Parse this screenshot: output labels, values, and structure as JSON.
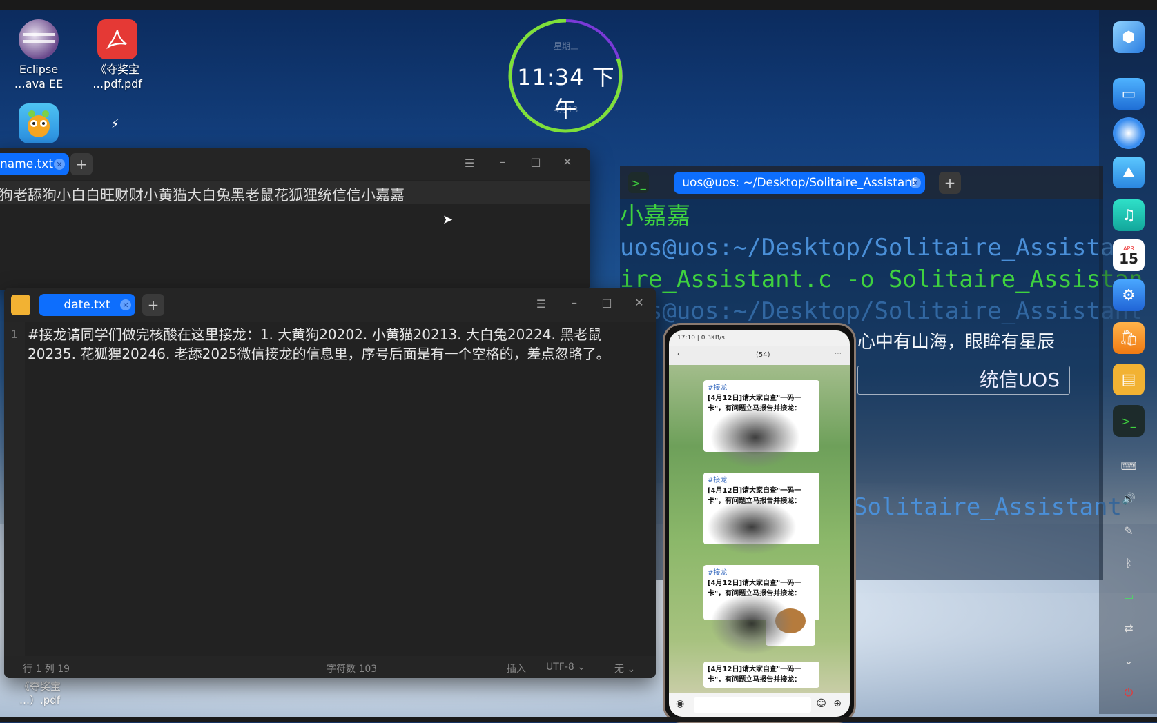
{
  "desktop": {
    "icons": [
      {
        "label_line1": "Eclipse",
        "label_line2": "…ava EE",
        "icon": "eclipse-icon"
      },
      {
        "label_line1": "《夺奖宝",
        "label_line2": "…pdf.pdf",
        "icon": "pdf-icon"
      },
      {
        "label_line1": "",
        "label_line2": "",
        "icon": "game-icon"
      },
      {
        "label_line1": "《夺奖宝",
        "label_line2": "…）.pdf",
        "icon": "pdf-icon"
      }
    ]
  },
  "clock": {
    "time": "11:34 下午",
    "top_small": "星期三",
    "bottom_small": "4月13"
  },
  "name_editor": {
    "tab_label": "name.txt",
    "content": "狗老舔狗小白白旺财财小黄猫大白兔黑老鼠花狐狸统信信小嘉嘉"
  },
  "date_editor": {
    "tab_label": "date.txt",
    "line_number": "1",
    "content": "#接龙请同学们做完核酸在这里接龙：1. 大黄狗20202. 小黄猫20213. 大白兔20224. 黑老鼠20235. 花狐狸20246. 老舔2025微信接龙的信息里，序号后面是有一个空格的，差点忽略了。",
    "status": {
      "position": "行 1  列 19",
      "char_count": "字符数 103",
      "mode": "插入",
      "encoding": "UTF-8",
      "highlight": "无"
    }
  },
  "terminal": {
    "tab_label": "uos@uos: ~/Desktop/Solitaire_Assistant",
    "lines": [
      "小嘉嘉",
      "uos@uos:~/Desktop/Solitaire_Assistant",
      "ire_Assistant.c -o Solitaire_Assistan",
      "uos@uos:~/Desktop/Solitaire_Assistant",
      "Solitaire_Assistant"
    ],
    "wallpaper_slogan": "心中有山海，眼眸有星辰",
    "brand": "统信UOS"
  },
  "phone": {
    "status_left": "17:10 | 0.3KB/s",
    "chat_count": "(54)",
    "cards": [
      {
        "tag": "#接龙",
        "text": "[4月12日]请大家自查\"一码一卡\"，有问题立马报告并接龙："
      },
      {
        "tag": "#接龙",
        "text": "[4月12日]请大家自查\"一码一卡\"，有问题立马报告并接龙："
      },
      {
        "tag": "#接龙",
        "text": "[4月12日]请大家自查\"一码一卡\"，有问题立马报告并接龙："
      },
      {
        "tag": "",
        "text": "[4月12日]请大家自查\"一码一卡\"，有问题立马报告并接龙："
      }
    ]
  },
  "dock": {
    "calendar_day": "15",
    "calendar_month": "APR"
  },
  "colors": {
    "accent": "#0d6efd",
    "terminal_green": "#3fd23f",
    "terminal_blue": "#4a8fd8"
  }
}
